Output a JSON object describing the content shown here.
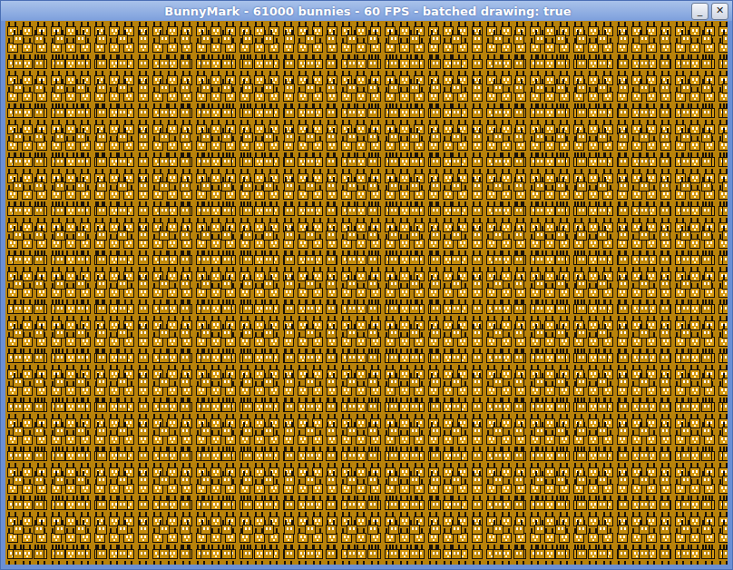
{
  "window": {
    "title": "BunnyMark - 61000 bunnies - 60 FPS - batched drawing: true"
  },
  "title_buttons": [
    "_",
    "✕"
  ]
}
